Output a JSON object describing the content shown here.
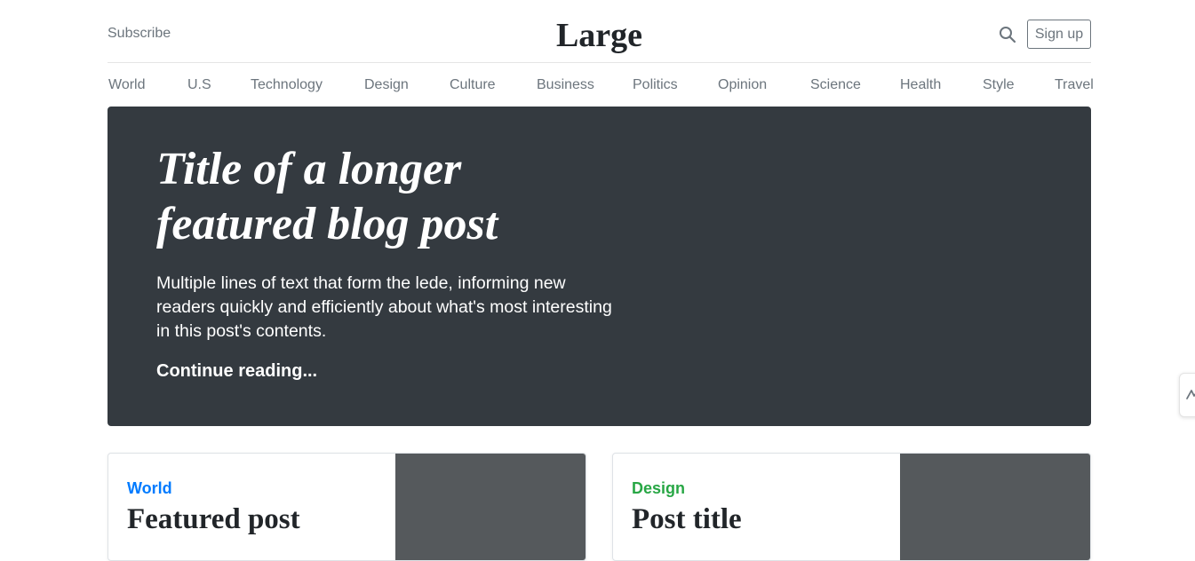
{
  "header": {
    "subscribe_label": "Subscribe",
    "brand": "Large",
    "search_icon": "search-icon",
    "signup_label": "Sign up"
  },
  "nav": {
    "items": [
      "World",
      "U.S",
      "Technology",
      "Design",
      "Culture",
      "Business",
      "Politics",
      "Opinion",
      "Science",
      "Health",
      "Style",
      "Travel"
    ]
  },
  "hero": {
    "title": "Title of a longer featured blog post",
    "lede": "Multiple lines of text that form the lede, informing new readers quickly and efficiently about what's most interesting in this post's contents.",
    "link": "Continue reading..."
  },
  "cards": [
    {
      "category": "World",
      "category_color": "#007bff",
      "title": "Featured post"
    },
    {
      "category": "Design",
      "category_color": "#28a745",
      "title": "Post title"
    }
  ],
  "colors": {
    "hero_bg": "#343a40",
    "muted": "#6c757d",
    "thumb": "#55595c"
  }
}
